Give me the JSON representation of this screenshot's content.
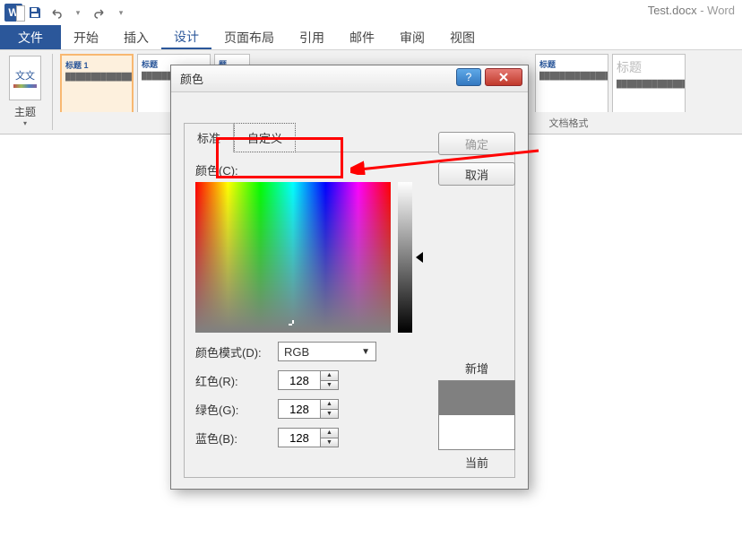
{
  "app": {
    "title": "Test.docx",
    "suffix": " - Word"
  },
  "qat": {
    "save": "保存",
    "undo": "撤销",
    "redo": "重做"
  },
  "ribbon": {
    "tabs": [
      "文件",
      "开始",
      "插入",
      "设计",
      "页面布局",
      "引用",
      "邮件",
      "审阅",
      "视图"
    ],
    "active_index": 3,
    "themes_label": "主题",
    "gallery_group_label": "文档格式",
    "styles": [
      {
        "title": "标题 1"
      },
      {
        "title": "标题"
      },
      {
        "title": "题"
      },
      {
        "title": "标题"
      },
      {
        "title": "标题"
      }
    ],
    "style_alt_title": "标题"
  },
  "dialog": {
    "title": "颜色",
    "tab_standard": "标准",
    "tab_custom": "自定义",
    "colors_label": "颜色(C):",
    "mode_label": "颜色模式(D):",
    "mode_value": "RGB",
    "r_label": "红色(R):",
    "g_label": "绿色(G):",
    "b_label": "蓝色(B):",
    "r": "128",
    "g": "128",
    "b": "128",
    "ok": "确定",
    "cancel": "取消",
    "new_label": "新增",
    "current_label": "当前"
  }
}
